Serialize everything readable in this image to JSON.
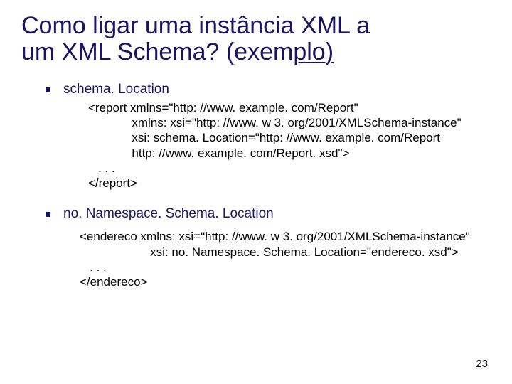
{
  "title": {
    "line1": "Como ligar uma instância XML a",
    "line2_pre_underline": "um XML Schema? (exem",
    "line2_underline_part": "plo)"
  },
  "bullets": {
    "b1_label": "schema. Location",
    "b2_label": "no. Namespace. Schema. Location"
  },
  "code1": "<report xmlns=\"http: //www. example. com/Report\"\n             xmlns: xsi=\"http: //www. w 3. org/2001/XMLSchema-instance\"\n             xsi: schema. Location=\"http: //www. example. com/Report\n             http: //www. example. com/Report. xsd\">\n   . . .\n</report>",
  "code2": "<endereco xmlns: xsi=\"http: //www. w 3. org/2001/XMLSchema-instance\"\n                     xsi: no. Namespace. Schema. Location=\"endereco. xsd\">\n   . . .\n</endereco>",
  "page_number": "23"
}
